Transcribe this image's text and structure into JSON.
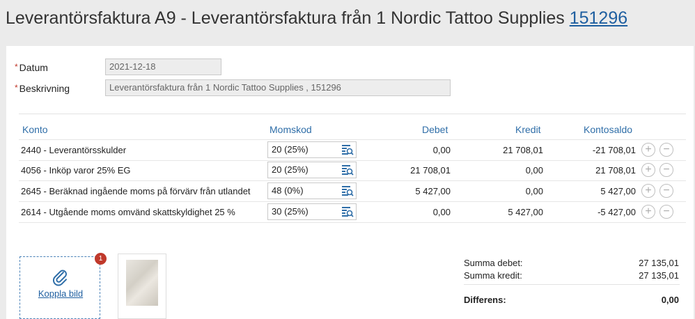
{
  "header": {
    "title": "Leverantörsfaktura A9  -  Leverantörsfaktura från 1 Nordic Tattoo Supplies",
    "link": "151296"
  },
  "form": {
    "required_mark": "*",
    "date_label": "Datum",
    "date_value": "2021-12-18",
    "desc_label": "Beskrivning",
    "desc_value": "Leverantörsfaktura från 1 Nordic Tattoo Supplies , 151296"
  },
  "table": {
    "headers": {
      "konto": "Konto",
      "momskod": "Momskod",
      "debet": "Debet",
      "kredit": "Kredit",
      "kontosaldo": "Kontosaldo"
    },
    "rows": [
      {
        "konto": "2440 - Leverantörsskulder",
        "momskod": "20 (25%)",
        "debet": "0,00",
        "kredit": "21 708,01",
        "saldo": "-21 708,01"
      },
      {
        "konto": "4056 - Inköp varor 25% EG",
        "momskod": "20 (25%)",
        "debet": "21 708,01",
        "kredit": "0,00",
        "saldo": "21 708,01"
      },
      {
        "konto": "2645 - Beräknad ingående moms på förvärv från utlandet",
        "momskod": "48 (0%)",
        "debet": "5 427,00",
        "kredit": "0,00",
        "saldo": "5 427,00"
      },
      {
        "konto": "2614 - Utgående moms omvänd skattskyldighet 25 %",
        "momskod": "30 (25%)",
        "debet": "0,00",
        "kredit": "5 427,00",
        "saldo": "-5 427,00"
      }
    ],
    "add_symbol": "+",
    "remove_symbol": "−"
  },
  "attachment": {
    "link_label": "Koppla bild",
    "badge_count": "1",
    "icon": "paperclip-icon"
  },
  "summary": {
    "debet_label": "Summa debet:",
    "debet_value": "27 135,01",
    "kredit_label": "Summa kredit:",
    "kredit_value": "27 135,01",
    "diff_label": "Differens:",
    "diff_value": "0,00"
  },
  "colors": {
    "accent": "#2f6ea8",
    "required": "#c0392b",
    "background": "#ebebeb"
  }
}
